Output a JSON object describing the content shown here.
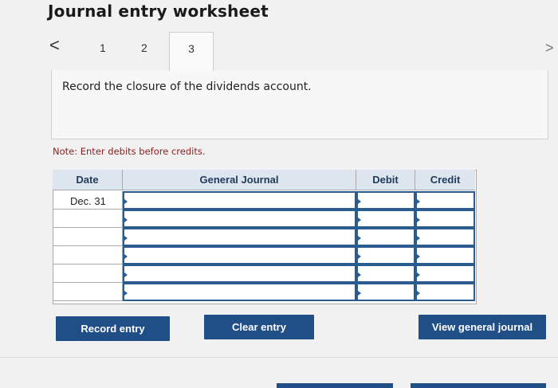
{
  "title": "Journal entry worksheet",
  "pager": {
    "prev_icon": "chevron-left-icon",
    "next_icon": "chevron-right-icon",
    "prev_glyph": "<",
    "next_glyph": ">"
  },
  "tabs": [
    {
      "label": "1",
      "active": false
    },
    {
      "label": "2",
      "active": false
    },
    {
      "label": "3",
      "active": true
    }
  ],
  "instruction": "Record the closure of the dividends account.",
  "note": "Note: Enter debits before credits.",
  "table": {
    "headers": {
      "date": "Date",
      "journal": "General Journal",
      "debit": "Debit",
      "credit": "Credit"
    },
    "rows": [
      {
        "date": "Dec. 31",
        "journal": "",
        "debit": "",
        "credit": ""
      },
      {
        "date": "",
        "journal": "",
        "debit": "",
        "credit": ""
      },
      {
        "date": "",
        "journal": "",
        "debit": "",
        "credit": ""
      },
      {
        "date": "",
        "journal": "",
        "debit": "",
        "credit": ""
      },
      {
        "date": "",
        "journal": "",
        "debit": "",
        "credit": ""
      },
      {
        "date": "",
        "journal": "",
        "debit": "",
        "credit": ""
      }
    ]
  },
  "buttons": {
    "record": "Record entry",
    "clear": "Clear entry",
    "view": "View general journal"
  },
  "colors": {
    "button": "#1f4f86",
    "header": "#dde6ee",
    "note": "#8b1e1e"
  }
}
